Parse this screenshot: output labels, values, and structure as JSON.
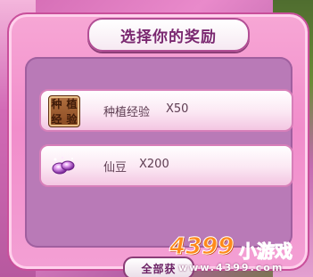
{
  "dialog": {
    "title": "选择你的奖励"
  },
  "rewards": [
    {
      "label": "种植经验",
      "quantity": "X50",
      "icon": "planting-experience-book-icon",
      "icon_text": [
        "种",
        "植",
        "经",
        "验"
      ]
    },
    {
      "label": "仙豆",
      "quantity": "X200",
      "icon": "fairy-bean-icon"
    }
  ],
  "claim_button": {
    "label": "全部获"
  },
  "watermark": {
    "brand": "4399",
    "name": "小游戏",
    "url": "www.4399.com"
  },
  "colors": {
    "panel_pink": "#f18dcb",
    "inner_purple": "#b97ab7",
    "title_text": "#7a2870",
    "brand_orange": "#ff8a1a",
    "brand_blue": "#2f8ede"
  }
}
